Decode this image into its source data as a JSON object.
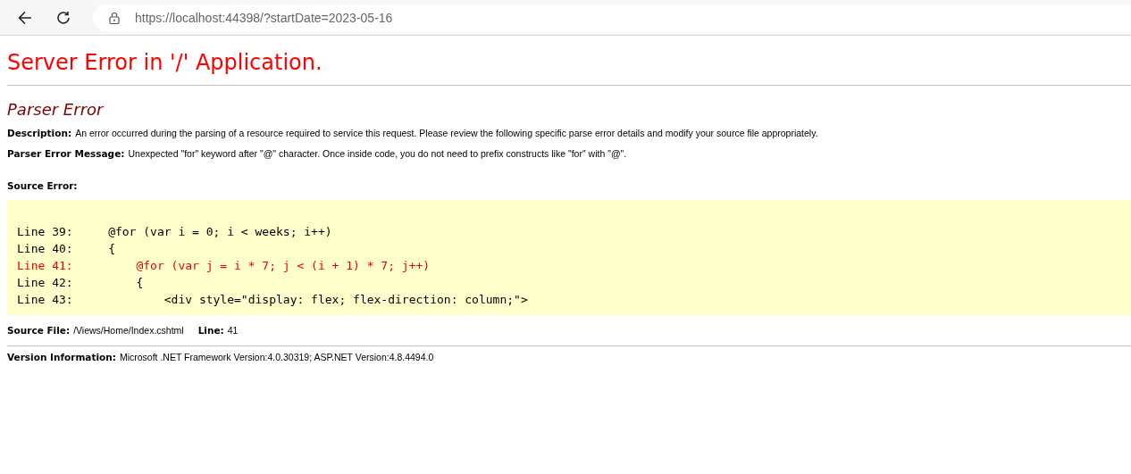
{
  "browser": {
    "url": "https://localhost:44398/?startDate=2023-05-16"
  },
  "page": {
    "title": "Server Error in '/' Application.",
    "subtitle": "Parser Error",
    "fields": [
      {
        "label": "Description:",
        "text": "An error occurred during the parsing of a resource required to service this request. Please review the following specific parse error details and modify your source file appropriately."
      },
      {
        "label": "Parser Error Message:",
        "text": "Unexpected \"for\" keyword after \"@\" character.  Once inside code, you do not need to prefix constructs like \"for\" with \"@\"."
      }
    ],
    "source_error_label": "Source Error:",
    "source_lines": [
      {
        "number": "Line 39:",
        "code": "     @for (var i = 0; i < weeks; i++)",
        "error": false
      },
      {
        "number": "Line 40:",
        "code": "     {",
        "error": false
      },
      {
        "number": "Line 41:",
        "code": "         @for (var j = i * 7; j < (i + 1) * 7; j++)",
        "error": true
      },
      {
        "number": "Line 42:",
        "code": "         {",
        "error": false
      },
      {
        "number": "Line 43:",
        "code": "             <div style=\"display: flex; flex-direction: column;\">",
        "error": false
      }
    ],
    "source_file": {
      "label": "Source File:",
      "path": "/Views/Home/Index.cshtml",
      "line_label": "Line:",
      "line": "41"
    },
    "version": {
      "label": "Version Information:",
      "text": "Microsoft .NET Framework Version:4.0.30319; ASP.NET Version:4.8.4494.0"
    }
  }
}
